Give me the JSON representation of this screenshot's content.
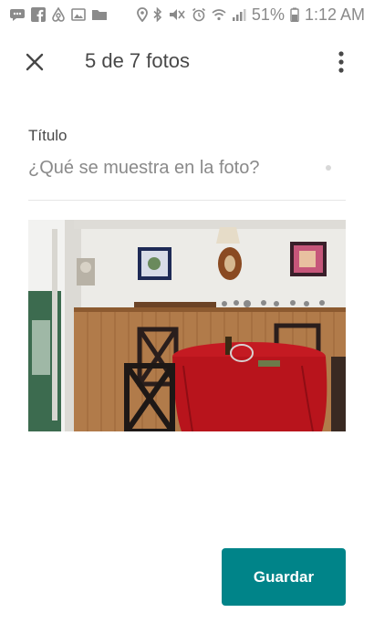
{
  "status_bar": {
    "battery_percent": "51%",
    "time": "1:12 AM",
    "left_icons": [
      "message-icon",
      "facebook-icon",
      "airbnb-icon",
      "image-icon",
      "folder-icon"
    ],
    "right_icons": [
      "location-icon",
      "bluetooth-icon",
      "mute-icon",
      "alarm-icon",
      "wifi-icon",
      "signal-icon",
      "battery-icon"
    ]
  },
  "header": {
    "title": "5 de 7 fotos",
    "close_icon": "close-icon",
    "more_icon": "more-vertical-icon"
  },
  "caption": {
    "label": "Título",
    "value": "",
    "placeholder": "¿Qué se muestra en la foto?"
  },
  "save_button": {
    "label": "Guardar"
  },
  "colors": {
    "accent": "#008489",
    "text_primary": "#484848",
    "text_secondary": "#8a8a8a",
    "divider": "#e6e6e6",
    "status_icons": "#8a8a8a"
  }
}
